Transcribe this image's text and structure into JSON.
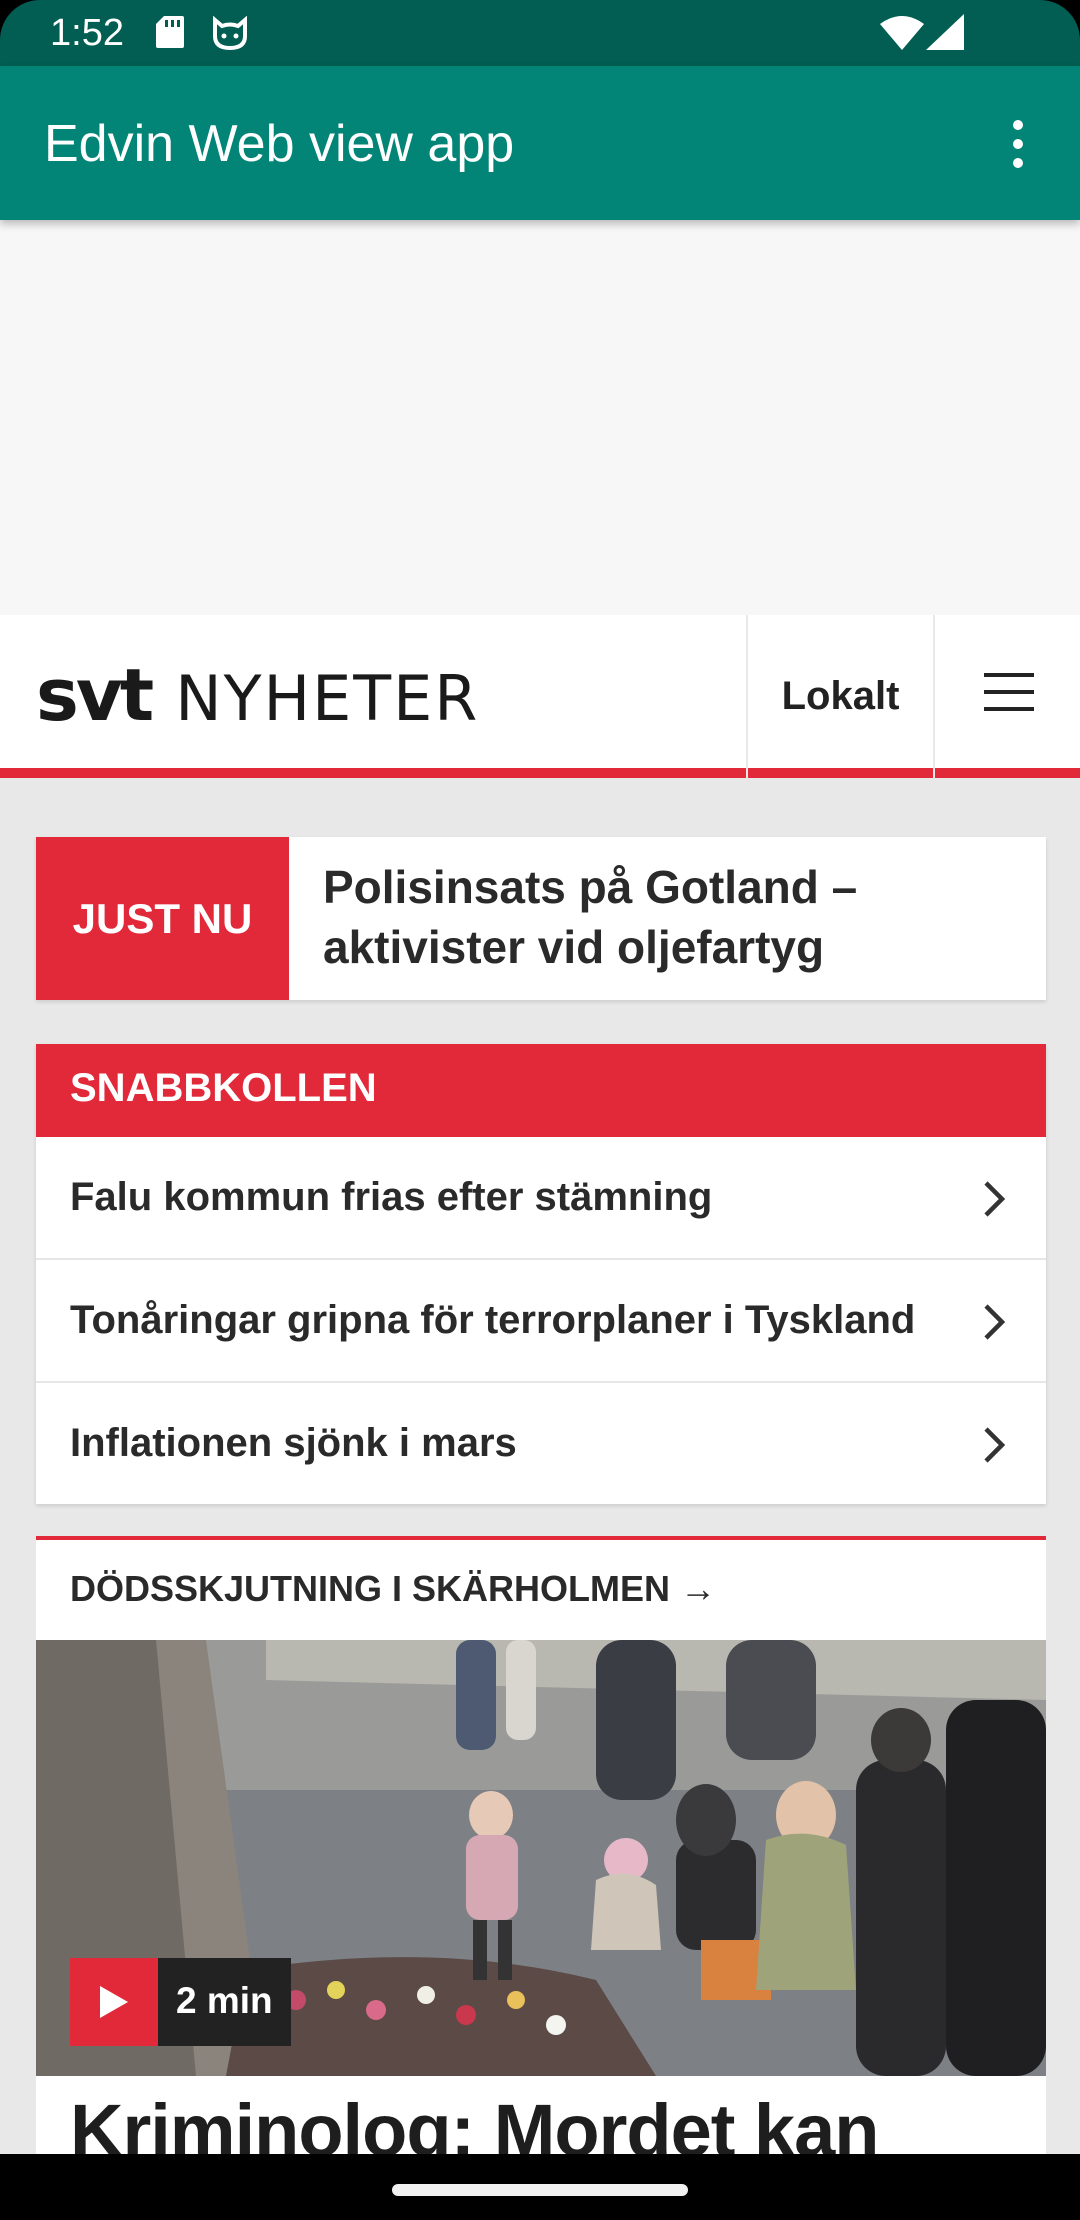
{
  "status_bar": {
    "time": "1:52",
    "icons": [
      "sd-card-icon",
      "cat-icon",
      "wifi-icon",
      "signal-icon"
    ]
  },
  "app_bar": {
    "title": "Edvin Web view app",
    "overflow_icon": "more-vert-icon"
  },
  "svt": {
    "logo_svt": "svt",
    "logo_nyheter": "NYHETER",
    "lokalt_label": "Lokalt",
    "menu_icon": "hamburger-menu-icon",
    "accent_color": "#e1293a"
  },
  "just_nu": {
    "badge": "JUST NU",
    "headline": "Polisinsats på Gotland – aktivister vid oljefartyg"
  },
  "snabbkollen": {
    "heading": "SNABBKOLLEN",
    "items": [
      {
        "label": "Falu kommun frias efter stämning"
      },
      {
        "label": "Tonåringar gripna för terrorplaner i Tyskland"
      },
      {
        "label": "Inflationen sjönk i mars"
      }
    ]
  },
  "article": {
    "kicker": "DÖDSSKJUTNING I SKÄRHOLMEN →",
    "video_duration": "2 min",
    "headline": "Kriminolog: Mordet kan"
  },
  "colors": {
    "status_bar": "#025e52",
    "app_bar": "#028577",
    "svt_red": "#e1293a"
  }
}
